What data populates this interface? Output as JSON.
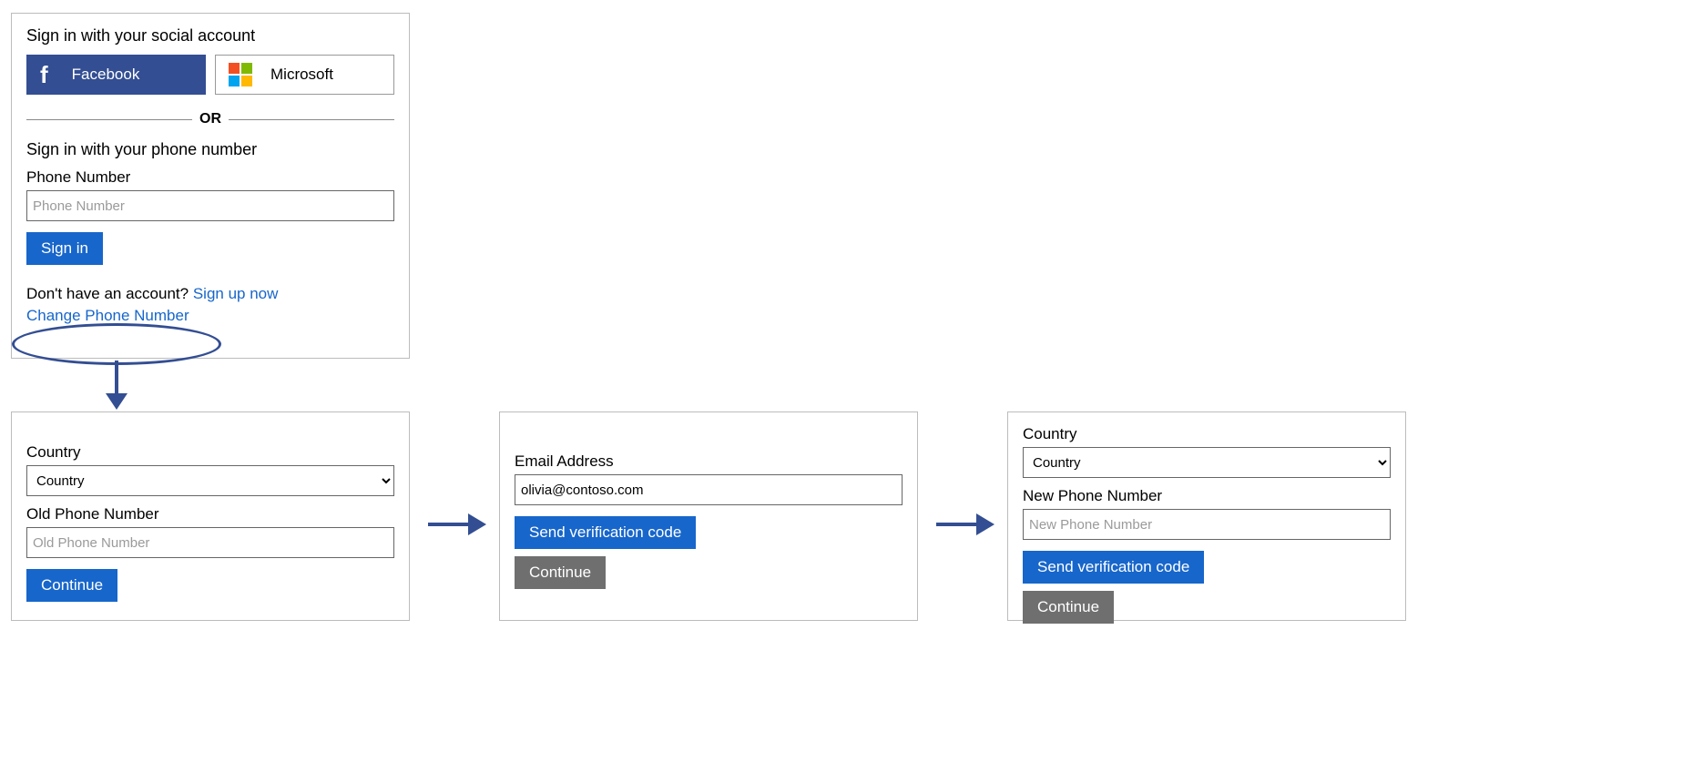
{
  "panel1": {
    "social_heading": "Sign in with your social account",
    "facebook_label": "Facebook",
    "microsoft_label": "Microsoft",
    "or_text": "OR",
    "phone_heading": "Sign in with your phone number",
    "phone_label": "Phone Number",
    "phone_placeholder": "Phone Number",
    "signin_button": "Sign in",
    "no_account_text": "Don't have an account? ",
    "signup_link": "Sign up now",
    "change_phone_link": "Change Phone Number"
  },
  "panel2": {
    "country_label": "Country",
    "country_value": "Country",
    "old_phone_label": "Old Phone Number",
    "old_phone_placeholder": "Old Phone Number",
    "continue_button": "Continue"
  },
  "panel3": {
    "email_label": "Email Address",
    "email_value": "olivia@contoso.com",
    "send_code_button": "Send verification code",
    "continue_button": "Continue"
  },
  "panel4": {
    "country_label": "Country",
    "country_value": "Country",
    "new_phone_label": "New Phone Number",
    "new_phone_placeholder": "New Phone Number",
    "send_code_button": "Send verification code",
    "continue_button": "Continue"
  }
}
